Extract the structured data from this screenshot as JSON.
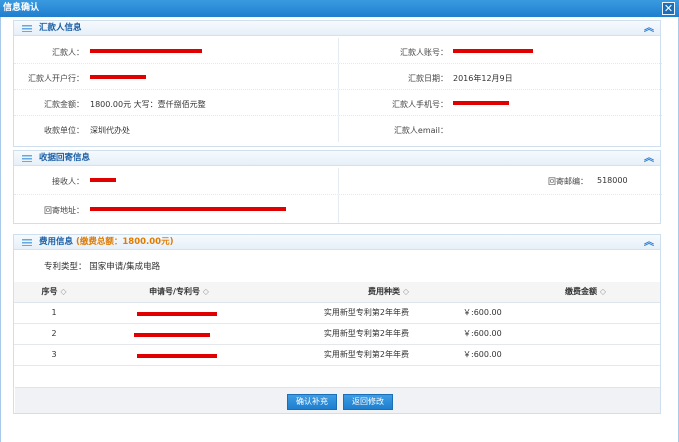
{
  "window": {
    "title": "信息确认",
    "close_symbol": "✕"
  },
  "remitter_section": {
    "title": "汇款人信息",
    "fields": {
      "remitter_label": "汇款人：",
      "account_label": "汇款人账号：",
      "bank_label": "汇款人开户行：",
      "date_label": "汇款日期：",
      "date_value": "2016年12月9日",
      "amount_label": "汇款金额：",
      "amount_value": "1800.00元 大写：壹仟捌佰元整",
      "phone_label": "汇款人手机号：",
      "payee_label": "收款单位：",
      "payee_value": "深圳代办处",
      "email_label": "汇款人email："
    }
  },
  "receipt_section": {
    "title": "收据回寄信息",
    "fields": {
      "recipient_label": "接收人：",
      "postcode_label": "回寄邮编：",
      "postcode_value": "518000",
      "address_label": "回寄地址："
    }
  },
  "fee_section": {
    "title": "费用信息",
    "total_text": "(缴费总额：1800.00元)",
    "patent_type_label": "专利类型：",
    "patent_type_value": "国家申请/集成电路",
    "columns": {
      "seq": "序号",
      "appno": "申请号/专利号",
      "fee_type": "费用种类",
      "amount": "缴费金额"
    },
    "sort_symbol": "◇",
    "rows": [
      {
        "seq": "1",
        "fee_type": "实用新型专利第2年年费",
        "amount": "￥:600.00"
      },
      {
        "seq": "2",
        "fee_type": "实用新型专利第2年年费",
        "amount": "￥:600.00"
      },
      {
        "seq": "3",
        "fee_type": "实用新型专利第2年年费",
        "amount": "￥:600.00"
      }
    ]
  },
  "actions": {
    "confirm_label": "确认补充",
    "back_label": "返回修改"
  },
  "colors": {
    "redaction": "#e00000",
    "accent": "#1f7fcf",
    "total_highlight": "#e07b00"
  }
}
